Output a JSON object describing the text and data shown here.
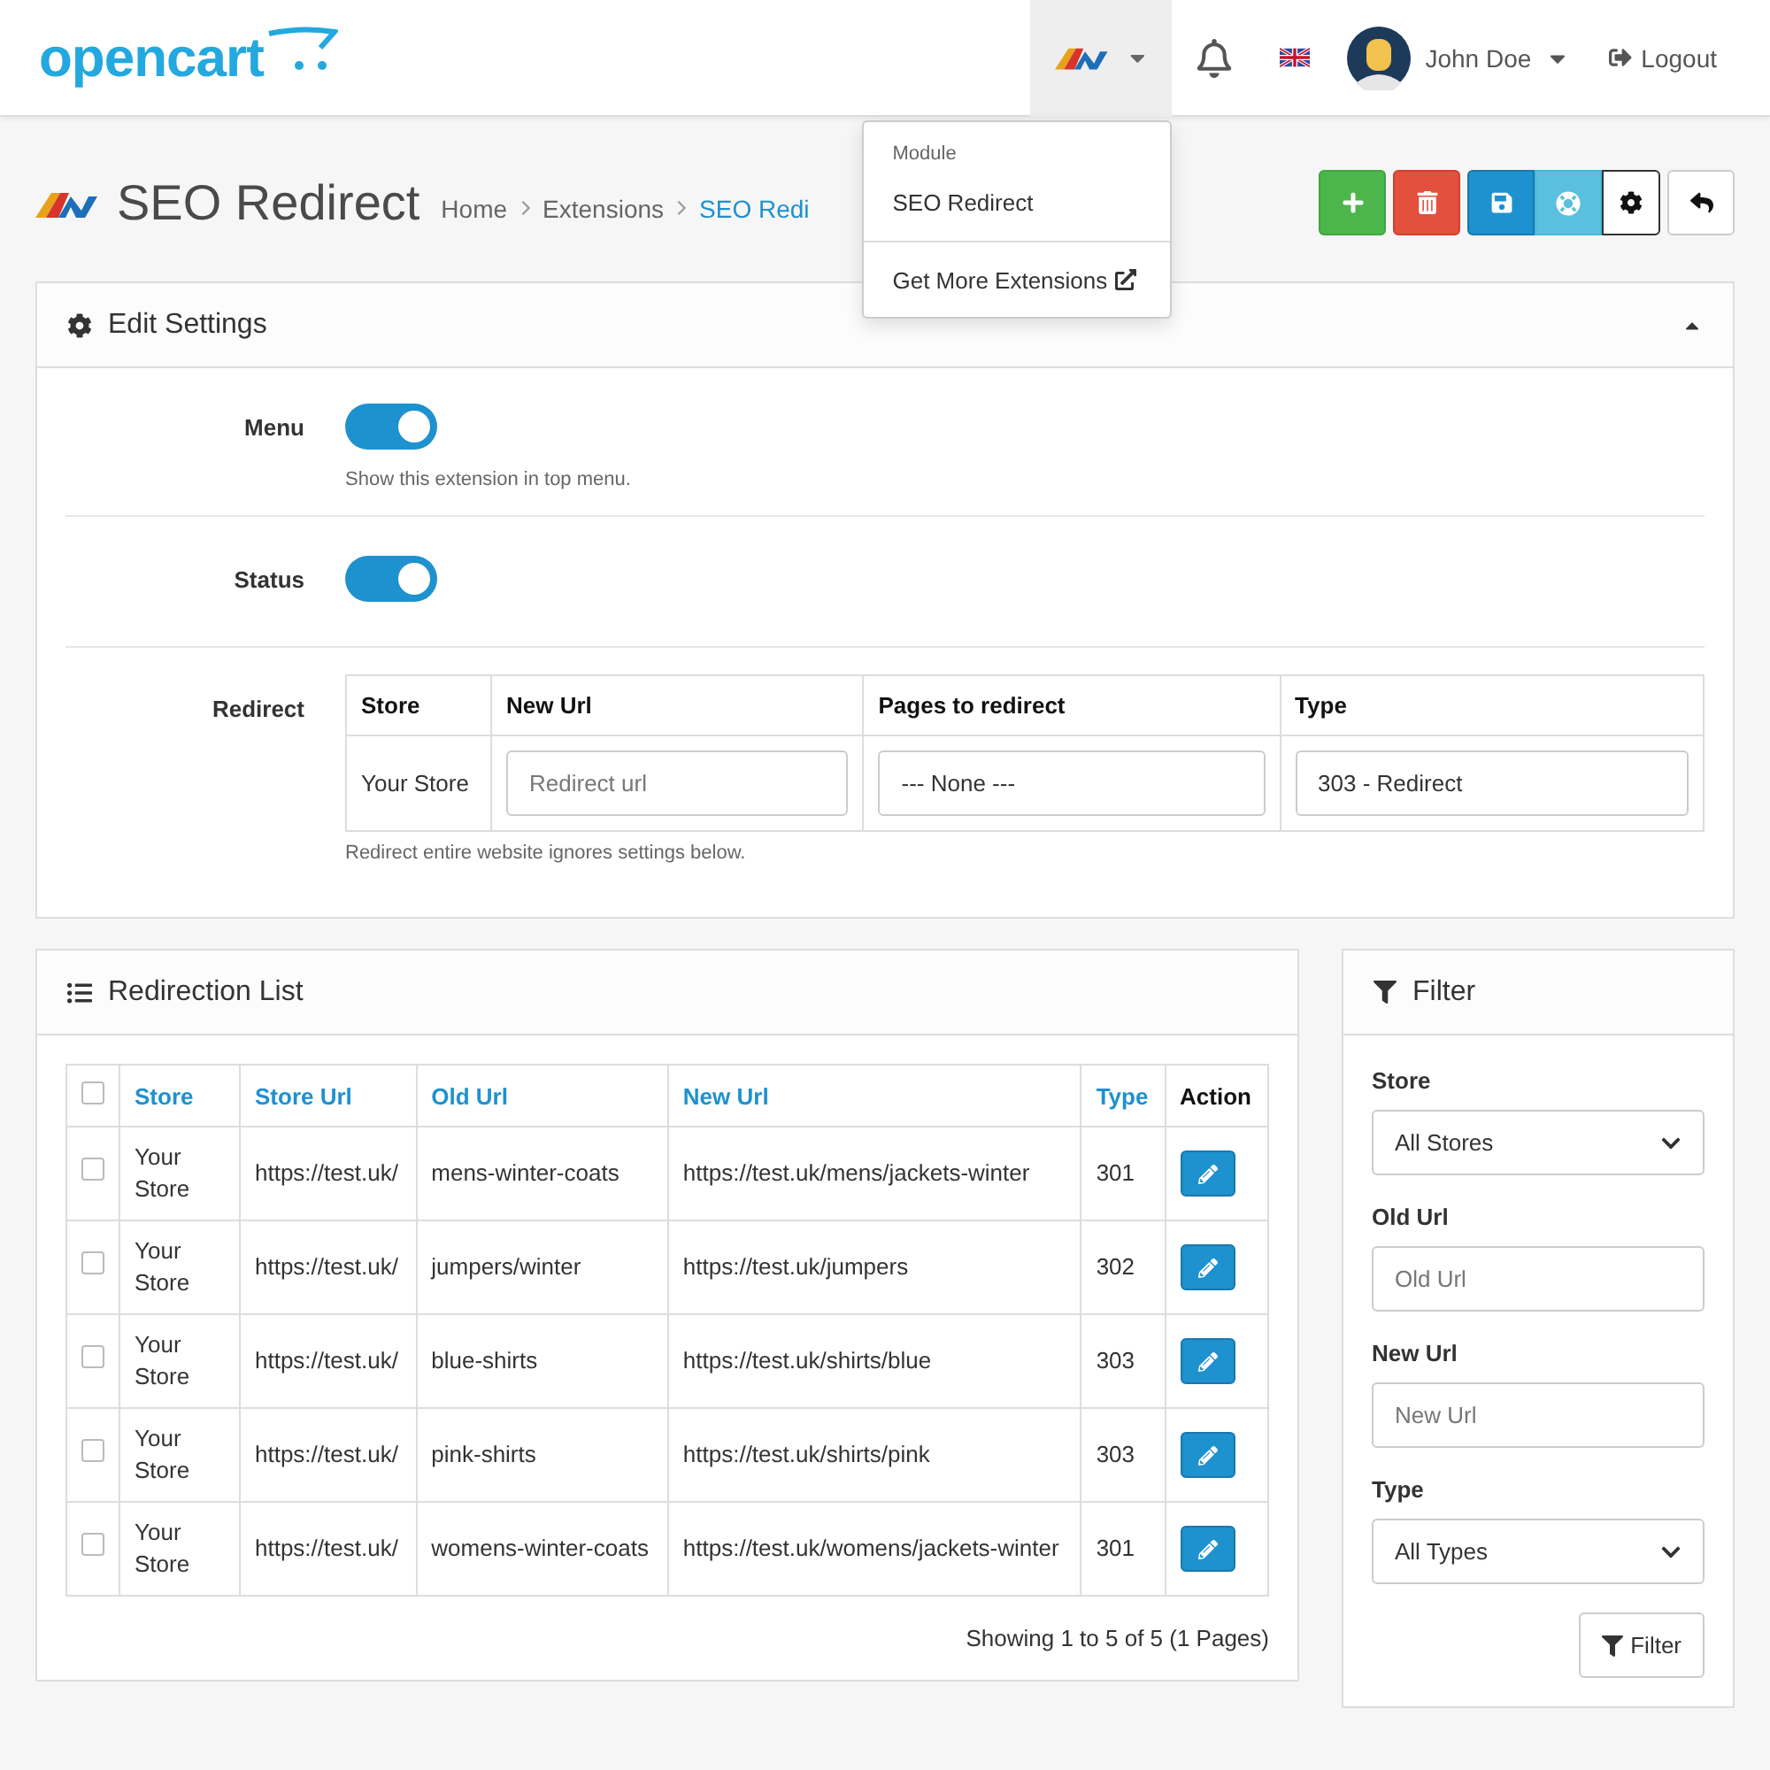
{
  "header": {
    "logo": "opencart",
    "user": "John Doe",
    "logout": "Logout"
  },
  "extension_menu": {
    "expanded": true,
    "heading": "Module",
    "items": [
      "SEO Redirect"
    ],
    "footer_link": "Get More Extensions"
  },
  "page": {
    "title": "SEO Redirect",
    "breadcrumbs": [
      "Home",
      "Extensions",
      "SEO Redi"
    ]
  },
  "edit_settings": {
    "title": "Edit Settings",
    "expanded": true,
    "toggles": [
      {
        "label": "Menu",
        "on": true,
        "help": "Show this extension in top menu."
      },
      {
        "label": "Status",
        "on": true
      }
    ],
    "redirect": {
      "label": "Redirect",
      "columns": [
        "Store",
        "New Url",
        "Pages to redirect",
        "Type"
      ],
      "store": "Your Store",
      "new_url_placeholder": "Redirect url",
      "pages": "--- None ---",
      "type": "303 - Redirect",
      "help": "Redirect entire website ignores settings below."
    }
  },
  "redirection_list": {
    "title": "Redirection List",
    "select_all_checked": false,
    "columns": [
      {
        "label": "Store",
        "sortable": true
      },
      {
        "label": "Store Url",
        "sortable": true
      },
      {
        "label": "Old Url",
        "sortable": true
      },
      {
        "label": "New Url",
        "sortable": true
      },
      {
        "label": "Type",
        "sortable": true
      },
      {
        "label": "Action",
        "sortable": false
      }
    ],
    "rows": [
      {
        "checked": false,
        "store": "Your Store",
        "store_url": "https://test.uk/",
        "old_url": "mens-winter-coats",
        "new_url": "https://test.uk/mens/jackets-winter",
        "type": "301"
      },
      {
        "checked": false,
        "store": "Your Store",
        "store_url": "https://test.uk/",
        "old_url": "jumpers/winter",
        "new_url": "https://test.uk/jumpers",
        "type": "302"
      },
      {
        "checked": false,
        "store": "Your Store",
        "store_url": "https://test.uk/",
        "old_url": "blue-shirts",
        "new_url": "https://test.uk/shirts/blue",
        "type": "303"
      },
      {
        "checked": false,
        "store": "Your Store",
        "store_url": "https://test.uk/",
        "old_url": "pink-shirts",
        "new_url": "https://test.uk/shirts/pink",
        "type": "303"
      },
      {
        "checked": false,
        "store": "Your Store",
        "store_url": "https://test.uk/",
        "old_url": "womens-winter-coats",
        "new_url": "https://test.uk/womens/jackets-winter",
        "type": "301"
      }
    ],
    "pagination": "Showing 1 to 5 of 5 (1 Pages)"
  },
  "filter": {
    "title": "Filter",
    "fields": [
      {
        "label": "Store",
        "kind": "select",
        "value": "All Stores"
      },
      {
        "label": "Old Url",
        "kind": "input",
        "placeholder": "Old Url"
      },
      {
        "label": "New Url",
        "kind": "input",
        "placeholder": "New Url"
      },
      {
        "label": "Type",
        "kind": "select",
        "value": "All Types"
      }
    ],
    "button": "Filter"
  }
}
